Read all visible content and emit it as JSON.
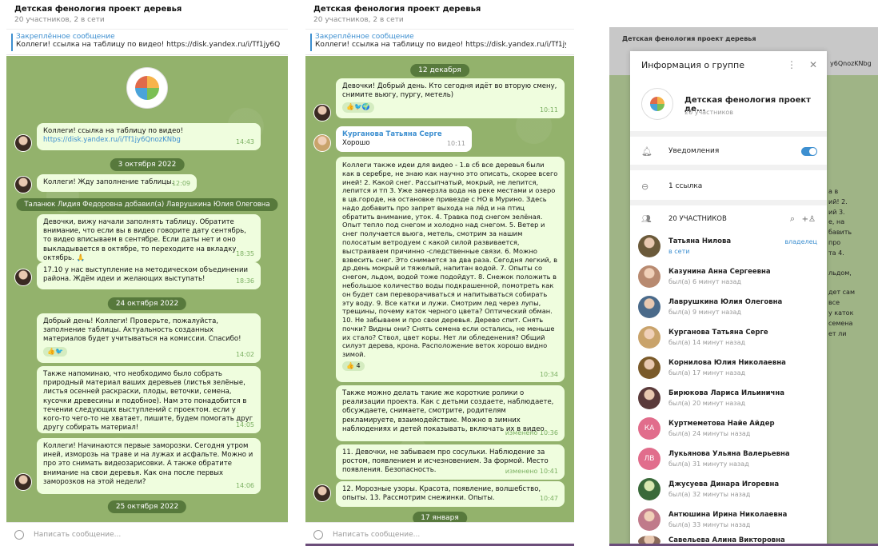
{
  "header": {
    "title": "Детская фенология проект деревья",
    "subtitle": "20 участников, 2 в сети"
  },
  "pinned": {
    "title": "Закреплённое сообщение",
    "text": "Коллеги! ссылка на таблицу по видео! https://disk.yandex.ru/i/Tf1jy6QnozKNbg"
  },
  "input_placeholder": "Написать сообщение...",
  "p1": {
    "m1": {
      "text": "Коллеги! ссылка на таблицу по видео!",
      "link": "https://disk.yandex.ru/i/Tf1jy6QnozKNbg",
      "time": "14:43"
    },
    "d1": "3 октября 2022",
    "m2": {
      "text": "Коллеги! Жду заполнение таблицы.",
      "time": "12:09"
    },
    "svc": "Таланюк Лидия Федоровна добавил(а) Лаврушкина Юлия Олеговна",
    "m3": {
      "text": "Девочки, вижу начали заполнять таблицу. Обратите внимание, что если вы в видео говорите дату сентябрь, то видео вписываем в сентябре. Если даты нет и оно выкладывается в октябре, то переходите на вкладку октябрь. 🙏",
      "time": "18:35"
    },
    "m4": {
      "text": "17.10 у нас выступление на методическом объединении района. Ждём идеи и желающих выступать!",
      "time": "18:36"
    },
    "d2": "24 октября 2022",
    "m5": {
      "text": "Добрый день! Коллеги! Проверьте, пожалуйста, заполнение таблицы. Актуальность  созданных материалов будет учитываться на комиссии. Спасибо!",
      "time": "14:02"
    },
    "m6": {
      "text": "Также напоминаю, что  необходимо было собрать природный материал ваших деревьев (листья зелёные, листья осенней раскраски, плоды, веточки, семена, кусочки древесины и подобное). Нам это понадобится в течении следующих выступлений с проектом. если у кого-то чего-то не хватает, пишите, будем помогать друг другу собирать материал!",
      "time": "14:05"
    },
    "m7": {
      "text": "Коллеги! Начинаются первые заморозки. Сегодня утром иней, изморозь на траве и на лужах и асфальте. Можно и про это снимать видеозарисовки. А также обратите внимание на свои деревья. Как она после первых заморозков на этой недели?",
      "time": "14:06"
    },
    "d3": "25 октября 2022"
  },
  "p2": {
    "d1": "12 декабря",
    "m1": {
      "text": "Девочки! Добрый день. Кто сегодня идёт во вторую смену, снимите вьюгу, пургу, метель)",
      "time": "10:11"
    },
    "m2": {
      "name": "Курганова Татьяна Серге",
      "text": "Хорошо",
      "time": "10:11"
    },
    "m3": {
      "text": "Коллеги также идеи для видео - 1.в сб все деревья были как в серебре, не знаю как научно это описать, скорее всего иней! 2. Какой снег. Рассыпчатый, мокрый, не лепится, лепится и тп 3. Уже замерзла вода на реке местами и озеро в цв.городе, на остановке привезде с НО в Мурино. Здесь надо добавить про запрет выхода на лёд и на птиц обратить внимание, уток. 4. Травка под снегом зелёная. Опыт тепло под снегом и холодно над снегом. 5. Ветер и снег получается вьюга, метель, смотрим за нашим полосатым ветродуем с какой силой развивается, выстраиваем причинно -следственные связи. 6. Можно взвесить снег. Это снимается за два раза. Сегодня легкий, в др.день мокрый и тяжелый, напитан водой. 7. Опыты со снегом, льдом, водой тоже подойдут. 8. Снежок положить в небольшое количество воды подкрашенной, помотреть как он будет сам переворачиваться и напитываться собирать эту воду. 9. Все катки и лужи. Смотрим лед через лупы, трещины, почему каток черного цвета? Оптический обман. 10. Не забываем и про свои деревья. Дерево спит. Снять почки? Видны они? Снять семена если остались, не меньше их стало? Ствол, цвет коры. Нет ли обледенения? Общий силуэт дерева, крона. Расположение веток хорошо видно зимой.",
      "reaction": "👍 4",
      "time": "10:34"
    },
    "m4": {
      "text": "Также можно делать такие же короткие ролики о реализации проекта. Как с детьми создаете, наблюдаете, обсуждаете, снимаете, смотрите, родителям рекламируете, взаимодействие. Можно в зимних наблюдениях и детей показывать, включать их в видео",
      "time": "изменено 10:36"
    },
    "m5": {
      "text": "11. Девочки, не забываем про сосульки. Наблюдение за ростом, появлением и исчезновением. За формой. Место появления. Безопасность.",
      "time": "изменено 10:41"
    },
    "m6": {
      "text": "12. Морозные узоры. Красота, появление, волшебство,  опыты. 13. Рассмотрим снежинки. Опыты.",
      "time": "10:47"
    },
    "d2": "17 января"
  },
  "p3": {
    "title": "Информация о группе",
    "group_name": "Детская фенология проект де...",
    "group_sub": "20 участников",
    "notif": "Уведомления",
    "links": "1 ссылка",
    "members_hdr": "20 УЧАСТНИКОВ",
    "owner_label": "владелец",
    "members": [
      {
        "name": "Татьяна Нилова",
        "status": "в сети",
        "color": "#6b5a3a"
      },
      {
        "name": "Казунина Анна Сергеевна",
        "status": "был(а) 6 минут назад",
        "color": "#b88a70"
      },
      {
        "name": "Лаврушкина Юлия Олеговна",
        "status": "был(а) 9 минут назад",
        "color": "#4a6a8a"
      },
      {
        "name": "Курганова Татьяна Серге",
        "status": "был(а) 14 минут назад",
        "color": "#c9a36b"
      },
      {
        "name": "Корнилова Юлия Николаевна",
        "status": "был(а) 17 минут назад",
        "color": "#7a5a2a"
      },
      {
        "name": "Бирюкова Лариса Ильинична",
        "status": "был(а) 20 минут назад",
        "color": "#5a3a3a"
      },
      {
        "name": "Куртмеметова Найе Айдер",
        "status": "был(а) 24 минуты назад",
        "color": "#e16d8c",
        "initials": "КА"
      },
      {
        "name": "Лукьянова Ульяна Валерьевна",
        "status": "был(а) 31 минуту назад",
        "color": "#e16d8c",
        "initials": "ЛВ"
      },
      {
        "name": "Джусуева Динара Игоревна",
        "status": "был(а) 32 минуты назад",
        "color": "#3a6a3a"
      },
      {
        "name": "Антюшина Ирина Николаевна",
        "status": "был(а) 33 минуты назад",
        "color": "#c07a8a"
      },
      {
        "name": "Савельева Алина Викторовна",
        "status": "",
        "color": "#8a6a5a"
      }
    ],
    "side": {
      "c1": "30",
      "c2": "а в",
      "c3": "ий! 2.",
      "c4": "ий 3.",
      "c5": "е, на",
      "c6": "бавить",
      "c7": "про",
      "c8": "та 4.",
      "c9": "",
      "c10": "льдом,",
      "c11": "дет сам",
      "c12": "все",
      "c13": "у каток",
      "c14": "семена",
      "c15": "ет ли",
      "c16": "",
      "c17": "10:34",
      "c18": "ации",
      "c19": "йствие,",
      "c20": "ать их",
      "c21": "10:36",
      "c22": "ростом,",
      "c23": "ения,",
      "c24": "10:41",
      "c25": "ыты.",
      "c26": "10:47"
    }
  }
}
